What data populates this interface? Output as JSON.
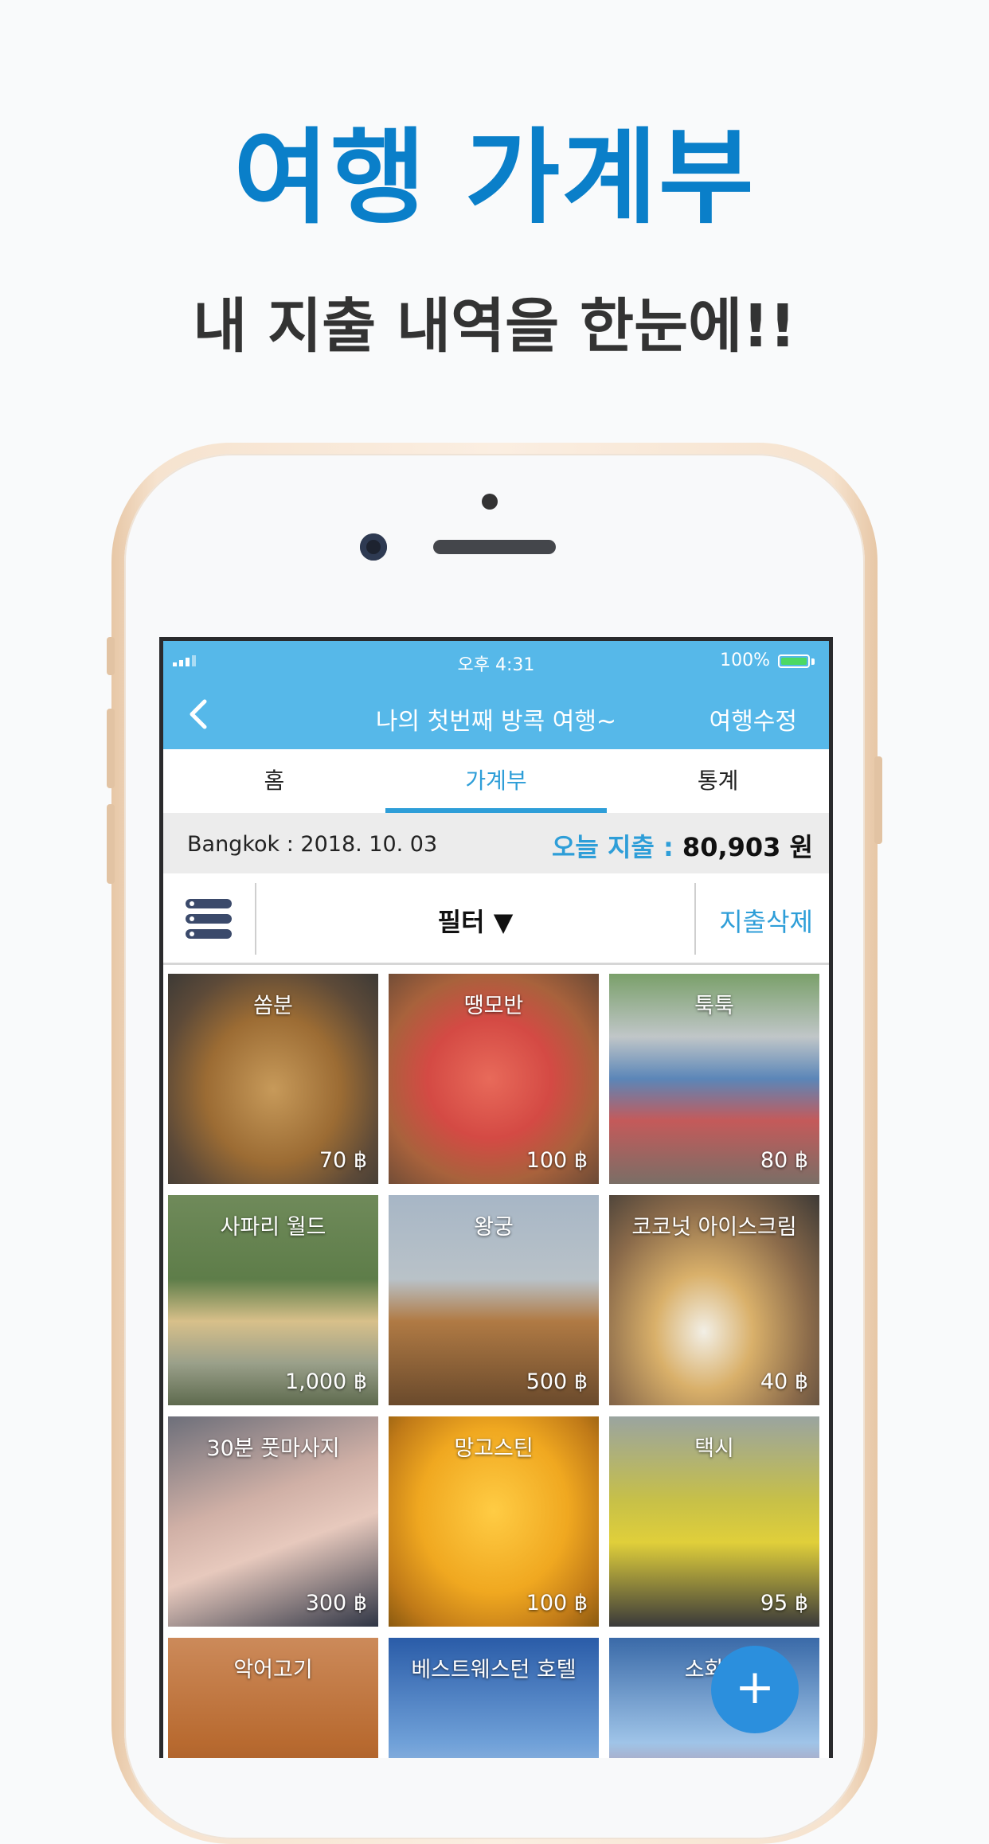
{
  "promo": {
    "title": "여행 가계부",
    "subtitle": "내 지출 내역을 한눈에!!"
  },
  "status_bar": {
    "time": "오후 4:31",
    "battery": "100%"
  },
  "nav": {
    "title": "나의 첫번째 방콕 여행~",
    "edit_label": "여행수정"
  },
  "tabs": [
    {
      "label": "홈",
      "active": false
    },
    {
      "label": "가계부",
      "active": true
    },
    {
      "label": "통계",
      "active": false
    }
  ],
  "info": {
    "location_date": "Bangkok : 2018. 10. 03",
    "today_label": "오늘 지출 :",
    "today_amount": "80,903 원"
  },
  "toolbar": {
    "filter_label": "필터 ▼",
    "delete_label": "지출삭제"
  },
  "expenses": [
    {
      "name": "쏨분",
      "price": "70 ฿"
    },
    {
      "name": "땡모반",
      "price": "100 ฿"
    },
    {
      "name": "툭툭",
      "price": "80 ฿"
    },
    {
      "name": "사파리 월드",
      "price": "1,000 ฿"
    },
    {
      "name": "왕궁",
      "price": "500 ฿"
    },
    {
      "name": "코코넛 아이스크림",
      "price": "40 ฿"
    },
    {
      "name": "30분 풋마사지",
      "price": "300 ฿"
    },
    {
      "name": "망고스틴",
      "price": "100 ฿"
    },
    {
      "name": "택시",
      "price": "95 ฿"
    },
    {
      "name": "악어고기",
      "price": ""
    },
    {
      "name": "베스트웨스턴 호텔",
      "price": ""
    },
    {
      "name": "소화제",
      "price": ""
    }
  ],
  "colors": {
    "brand_blue": "#0a7fc9",
    "header_blue": "#56b8e9",
    "accent_blue": "#2e9ed8",
    "fab_blue": "#2b8fdd"
  }
}
